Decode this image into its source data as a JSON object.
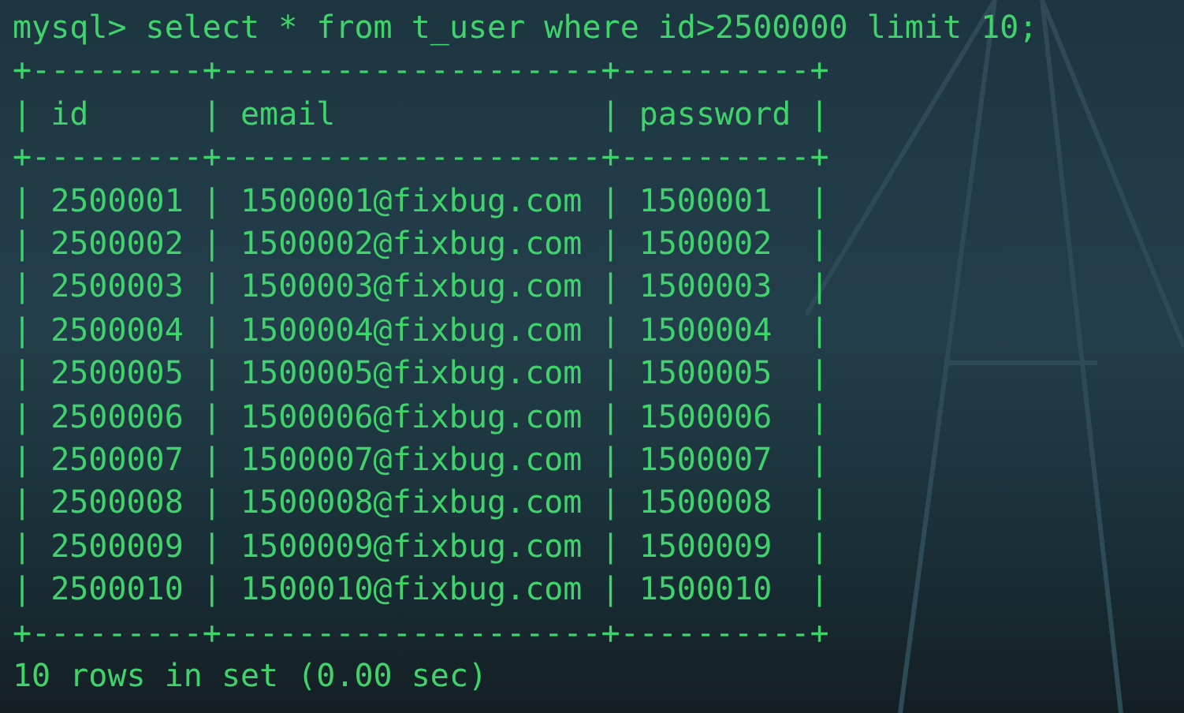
{
  "terminal": {
    "command_line": "mysql> select * from t_user where id>2500000 limit 10;",
    "table": {
      "border_line": "+---------+--------------------+----------+",
      "separator": "|",
      "columns": [
        {
          "label": "id"
        },
        {
          "label": "email"
        },
        {
          "label": "password"
        }
      ],
      "rows": [
        [
          "2500001",
          "1500001@fixbug.com",
          "1500001"
        ],
        [
          "2500002",
          "1500002@fixbug.com",
          "1500002"
        ],
        [
          "2500003",
          "1500003@fixbug.com",
          "1500003"
        ],
        [
          "2500004",
          "1500004@fixbug.com",
          "1500004"
        ],
        [
          "2500005",
          "1500005@fixbug.com",
          "1500005"
        ],
        [
          "2500006",
          "1500006@fixbug.com",
          "1500006"
        ],
        [
          "2500007",
          "1500007@fixbug.com",
          "1500007"
        ],
        [
          "2500008",
          "1500008@fixbug.com",
          "1500008"
        ],
        [
          "2500009",
          "1500009@fixbug.com",
          "1500009"
        ],
        [
          "2500010",
          "1500010@fixbug.com",
          "1500010"
        ]
      ]
    },
    "result_line": "10 rows in set (0.00 sec)"
  }
}
